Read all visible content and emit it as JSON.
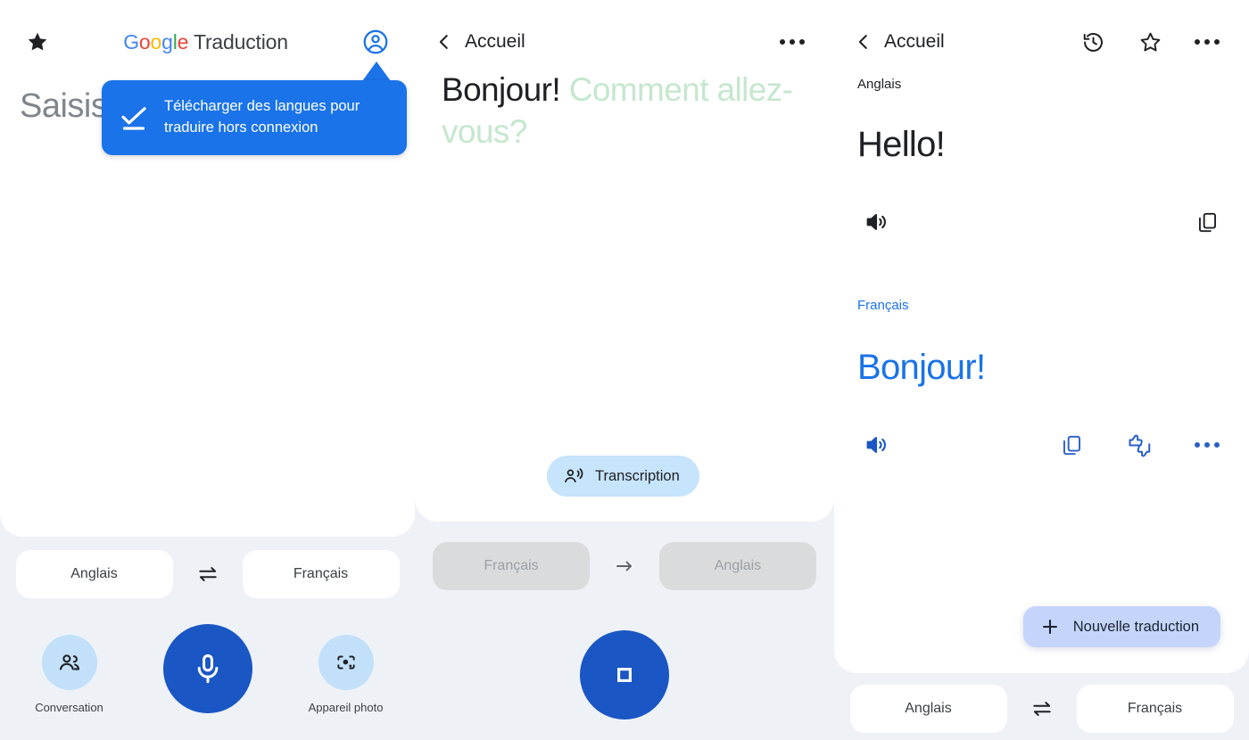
{
  "panel1": {
    "header": {
      "star_icon": "star-filled-icon",
      "brand": {
        "g1": "G",
        "o1": "o",
        "o2": "o",
        "g2": "g",
        "l1": "l",
        "e1": "e",
        "product": " Traduction"
      },
      "avatar_icon": "account-circle-icon"
    },
    "input_placeholder_visible": "Saisis",
    "tooltip": {
      "icon": "download-done-icon",
      "line1": "Télécharger des langues pour",
      "line2": "traduire hors connexion",
      "color": "#1a73e8"
    },
    "language_bar": {
      "source": "Anglais",
      "target": "Français",
      "swap_icon": "swap-horizontal-icon"
    },
    "actions": [
      {
        "name": "conversation",
        "icon": "two-people-icon",
        "label": "Conversation"
      },
      {
        "name": "microphone",
        "icon": "microphone-icon",
        "label": ""
      },
      {
        "name": "camera",
        "icon": "camera-lens-icon",
        "label": "Appareil photo"
      }
    ]
  },
  "panel2": {
    "header": {
      "back_label": "Accueil",
      "back_icon": "chevron-left-icon",
      "more_icon": "more-horizontal-icon"
    },
    "live": {
      "final_text": "Bonjour! ",
      "partial_text": "Comment allez-vous?"
    },
    "transcription_chip": {
      "label": "Transcription",
      "icon": "person-speaking-icon"
    },
    "language_bar": {
      "source": "Français",
      "target": "Anglais",
      "arrow_icon": "arrow-right-icon",
      "disabled": true
    },
    "stop_button": {
      "icon": "stop-square-icon"
    }
  },
  "panel3": {
    "header": {
      "back_label": "Accueil",
      "back_icon": "chevron-left-icon",
      "history_icon": "history-icon",
      "star_icon": "star-outline-icon",
      "more_icon": "more-horizontal-icon"
    },
    "source": {
      "language": "Anglais",
      "text": "Hello!",
      "speaker_icon": "volume-up-icon",
      "copy_icon": "copy-icon"
    },
    "target": {
      "language": "Français",
      "text": "Bonjour!",
      "speaker_icon": "volume-up-icon",
      "copy_icon": "copy-icon",
      "feedback_icon": "thumbs-up-down-icon",
      "more_icon": "more-horizontal-icon"
    },
    "new_translation": {
      "label": "Nouvelle traduction",
      "icon": "plus-icon"
    },
    "language_bar": {
      "source": "Anglais",
      "target": "Français",
      "swap_icon": "swap-horizontal-icon"
    }
  },
  "colors": {
    "accent_blue": "#1a73e8",
    "deep_blue": "#1a56c4",
    "page_bg": "#eef2f7",
    "chip_blue": "#c6e4fc",
    "fab_blue": "#c5d4fb",
    "partial_green": "#c5e7ce"
  }
}
